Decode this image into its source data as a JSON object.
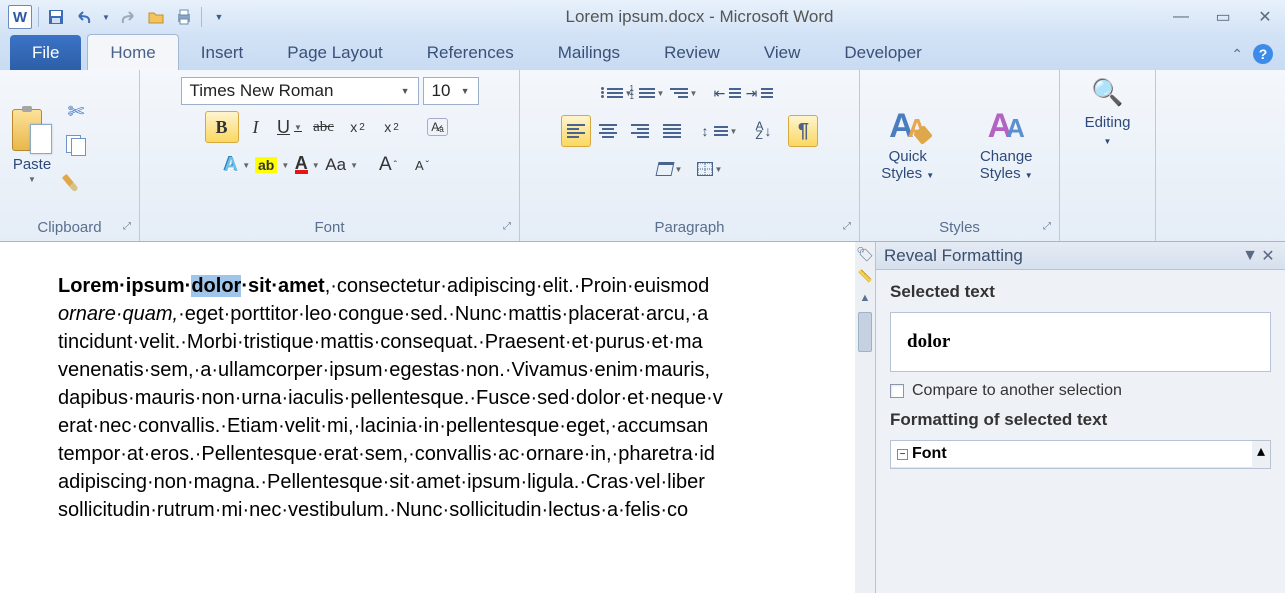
{
  "title": "Lorem ipsum.docx  -  Microsoft Word",
  "app_letter": "W",
  "tabs": {
    "file": "File",
    "home": "Home",
    "insert": "Insert",
    "page_layout": "Page Layout",
    "references": "References",
    "mailings": "Mailings",
    "review": "Review",
    "view": "View",
    "developer": "Developer"
  },
  "groups": {
    "clipboard": {
      "label": "Clipboard",
      "paste": "Paste"
    },
    "font": {
      "label": "Font",
      "font_name": "Times New Roman",
      "font_size": "10",
      "bold": "B",
      "italic": "I",
      "underline": "U",
      "strike": "abc",
      "sub_x": "x",
      "sup_x": "x",
      "clear": "Aa",
      "effects": "A",
      "highlight": "ab",
      "color": "A",
      "case": "Aa",
      "grow_shrink": "A"
    },
    "paragraph": {
      "label": "Paragraph",
      "pilcrow": "¶",
      "sort_a": "A",
      "sort_z": "Z"
    },
    "styles": {
      "label": "Styles",
      "quick": "Quick Styles",
      "change": "Change Styles"
    },
    "editing": {
      "label": "Editing"
    }
  },
  "document": {
    "line1_a": "Lorem·ipsum·",
    "line1_sel": "dolor",
    "line1_b": "·sit·amet",
    "line1_c": ",·consectetur·adipiscing·elit.·Proin·euismod",
    "line2_a": "ornare·quam,",
    "line2_b": "·eget·porttitor·leo·congue·sed.·Nunc·mattis·placerat·arcu,·a",
    "line3": "tincidunt·velit.·Morbi·tristique·mattis·consequat.·Praesent·et·purus·et·ma",
    "line4": "venenatis·sem,·a·ullamcorper·ipsum·egestas·non.·Vivamus·enim·mauris,",
    "line5": "dapibus·mauris·non·urna·iaculis·pellentesque.·Fusce·sed·dolor·et·neque·v",
    "line6": "erat·nec·convallis.·Etiam·velit·mi,·lacinia·in·pellentesque·eget,·accumsan",
    "line7": "tempor·at·eros.·Pellentesque·erat·sem,·convallis·ac·ornare·in,·pharetra·id",
    "line8": "adipiscing·non·magna.·Pellentesque·sit·amet·ipsum·ligula.·Cras·vel·liber",
    "line9": "sollicitudin·rutrum·mi·nec·vestibulum.·Nunc·sollicitudin·lectus·a·felis·co"
  },
  "pane": {
    "title": "Reveal Formatting",
    "selected_label": "Selected text",
    "selected_value": "dolor",
    "compare": "Compare to another selection",
    "formatting_label": "Formatting of selected text",
    "tree_font": "Font"
  }
}
